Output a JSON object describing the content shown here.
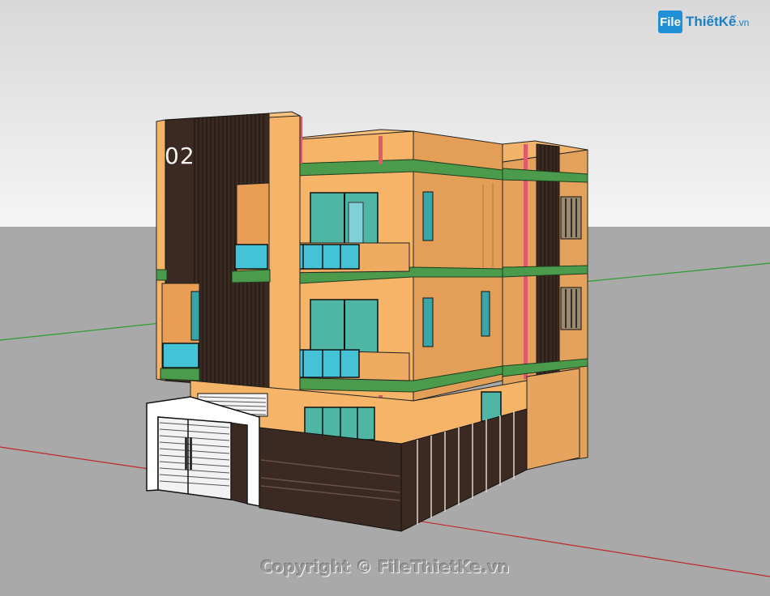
{
  "image": {
    "kind": "3D SketchUp model render of a three-storey townhouse facade",
    "colors": {
      "sky_top": "#d9d9d9",
      "sky_bottom": "#f4f4f4",
      "ground": "#a8a8a8",
      "wall_orange": "#f5b468",
      "wall_shade": "#d98f47",
      "band_green": "#4c9a4c",
      "accent_pink": "#e05a6a",
      "dark_cladding": "#3a2a22",
      "glass": "#59bfc4",
      "gate_white": "#ffffff"
    }
  },
  "logo": {
    "mark": "File",
    "text": "ThiếtKế",
    "tld": ".vn"
  },
  "building": {
    "house_number": "02"
  },
  "watermark": {
    "copyright": "Copyright © FileThietKe.vn"
  }
}
